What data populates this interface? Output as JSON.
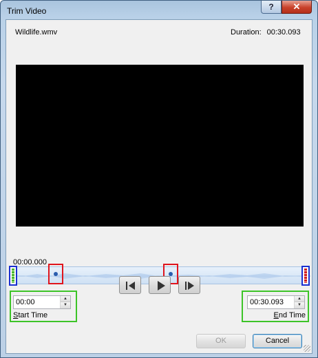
{
  "window": {
    "title": "Trim Video",
    "help_label": "?",
    "close_label": "✕"
  },
  "file": {
    "name": "Wildlife.wmv",
    "duration_label": "Duration:",
    "duration_value": "00:30.093"
  },
  "timeline": {
    "current_time": "00:00.000"
  },
  "start": {
    "value": "00:00",
    "label_prefix": "S",
    "label_rest": "tart Time"
  },
  "end": {
    "value": "00:30.093",
    "label_prefix": "E",
    "label_rest": "nd Time"
  },
  "buttons": {
    "ok": "OK",
    "cancel": "Cancel"
  },
  "icons": {
    "prev_frame": "previous-frame-icon",
    "play": "play-icon",
    "next_frame": "next-frame-icon"
  },
  "colors": {
    "annotation_red": "#e0141c",
    "annotation_blue": "#1a2fd0",
    "annotation_green": "#3cc427"
  }
}
